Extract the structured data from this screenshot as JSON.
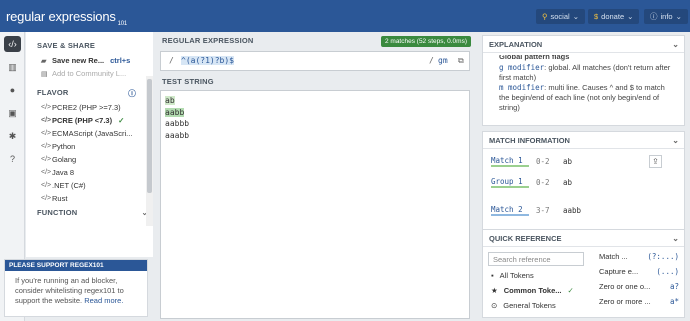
{
  "topbar": {
    "logo": "regular expressions",
    "logo_version": "101",
    "social": "social",
    "donate": "donate",
    "info": "info"
  },
  "rail": {
    "items": [
      "regex-editor",
      "library",
      "account",
      "quiz",
      "settings",
      "help"
    ]
  },
  "sidebar": {
    "save_share_title": "SAVE & SHARE",
    "save_new": "Save new Re...",
    "save_shortcut": "ctrl+s",
    "add_community": "Add to Community L...",
    "flavor_title": "FLAVOR",
    "flavors": [
      {
        "label": "PCRE2 (PHP >=7.3)",
        "selected": false
      },
      {
        "label": "PCRE (PHP <7.3)",
        "selected": true
      },
      {
        "label": "ECMAScript (JavaScri...",
        "selected": false
      },
      {
        "label": "Python",
        "selected": false
      },
      {
        "label": "Golang",
        "selected": false
      },
      {
        "label": "Java 8",
        "selected": false
      },
      {
        "label": ".NET (C#)",
        "selected": false
      },
      {
        "label": "Rust",
        "selected": false
      }
    ],
    "function_title": "FUNCTION"
  },
  "support": {
    "header": "PLEASE SUPPORT REGEX101",
    "text": "If you're running an ad blocker, consider whitelisting regex101 to support the website.",
    "link": "Read more."
  },
  "editor": {
    "regex_label": "REGULAR EXPRESSION",
    "match_badge": "2 matches (52 steps, 0.0ms)",
    "delimiter_open": "/",
    "pattern": {
      "p1": "^(a(?1)?b)$"
    },
    "delimiter_close": "/",
    "flags": "gm",
    "test_label": "TEST STRING",
    "lines": [
      "ab",
      "aabb",
      "aabbb",
      "aaabb"
    ]
  },
  "explanation": {
    "title": "EXPLANATION",
    "heading": "Global pattern flags",
    "g_mod": "g modifier",
    "g_text": ": global. All matches (don't return after first match)",
    "m_mod": "m modifier",
    "m_text": ": multi line. Causes ^ and $ to match the begin/end of each line (not only begin/end of string)"
  },
  "match_info": {
    "title": "MATCH INFORMATION",
    "rows": [
      {
        "name": "Match 1",
        "pos": "0-2",
        "val": "ab"
      },
      {
        "name": "Group 1",
        "pos": "0-2",
        "val": "ab"
      },
      {
        "name": "Match 2",
        "pos": "3-7",
        "val": "aabb"
      }
    ]
  },
  "quick_ref": {
    "title": "QUICK REFERENCE",
    "search_placeholder": "Search reference",
    "cats": [
      {
        "icon": "all-tokens-icon",
        "label": "All Tokens"
      },
      {
        "icon": "star-icon",
        "label": "Common Toke..."
      },
      {
        "icon": "general-icon",
        "label": "General Tokens"
      }
    ],
    "tokens": [
      {
        "label": "Match ...",
        "code": "(?:...)"
      },
      {
        "label": "Capture e...",
        "code": "(...)"
      },
      {
        "label": "Zero or one o...",
        "code": "a?"
      },
      {
        "label": "Zero or more ...",
        "code": "a*"
      }
    ]
  }
}
